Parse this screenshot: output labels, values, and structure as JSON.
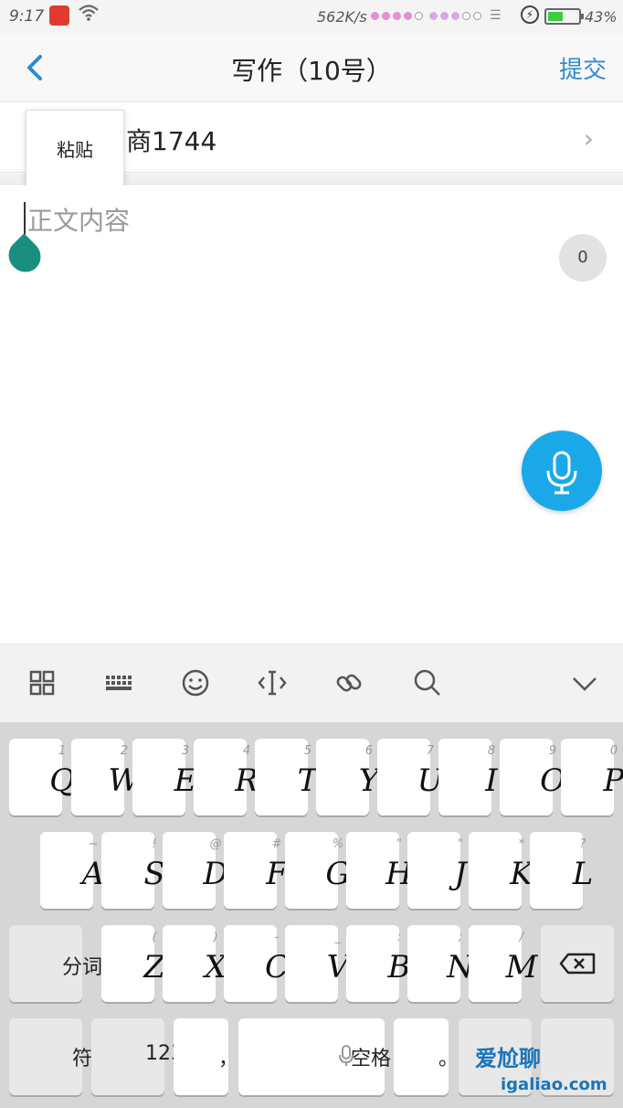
{
  "status_bar": {
    "time": "9:17",
    "network_speed": "562K/s",
    "battery_percent": "43%",
    "battery_level": 0.43
  },
  "header": {
    "title": "写作（10号）",
    "submit_label": "提交"
  },
  "category": {
    "label": "商1744"
  },
  "paste_popup": {
    "label": "粘贴"
  },
  "editor": {
    "placeholder": "正文内容",
    "char_count": "0"
  },
  "keyboard_toolbar": {
    "icons": [
      "apps-grid-icon",
      "keyboard-icon",
      "emoji-icon",
      "cursor-move-icon",
      "link-icon",
      "search-icon",
      "collapse-chevron-icon"
    ]
  },
  "keyboard": {
    "row1": [
      {
        "hint": "1",
        "key": "Q"
      },
      {
        "hint": "2",
        "key": "W"
      },
      {
        "hint": "3",
        "key": "E"
      },
      {
        "hint": "4",
        "key": "R"
      },
      {
        "hint": "5",
        "key": "T"
      },
      {
        "hint": "6",
        "key": "Y"
      },
      {
        "hint": "7",
        "key": "U"
      },
      {
        "hint": "8",
        "key": "I"
      },
      {
        "hint": "9",
        "key": "O"
      },
      {
        "hint": "0",
        "key": "P"
      }
    ],
    "row2": [
      {
        "hint": "~",
        "key": "A"
      },
      {
        "hint": "!",
        "key": "S"
      },
      {
        "hint": "@",
        "key": "D"
      },
      {
        "hint": "#",
        "key": "F"
      },
      {
        "hint": "%",
        "key": "G"
      },
      {
        "hint": "\"",
        "key": "H"
      },
      {
        "hint": "\"",
        "key": "J"
      },
      {
        "hint": "*",
        "key": "K"
      },
      {
        "hint": "?",
        "key": "L"
      }
    ],
    "row3": [
      {
        "hint": "(",
        "key": "Z"
      },
      {
        "hint": ")",
        "key": "X"
      },
      {
        "hint": "-",
        "key": "C"
      },
      {
        "hint": "_",
        "key": "V"
      },
      {
        "hint": ":",
        "key": "B"
      },
      {
        "hint": ";",
        "key": "N"
      },
      {
        "hint": "/",
        "key": "M"
      }
    ],
    "segment_label": "分词",
    "symbol_label": "符",
    "numeric_label": "123",
    "comma_label": "，",
    "space_label": "空格",
    "period_label": "。"
  },
  "watermark": {
    "logo_text": "爱尬聊",
    "url": "igaliao.com"
  }
}
